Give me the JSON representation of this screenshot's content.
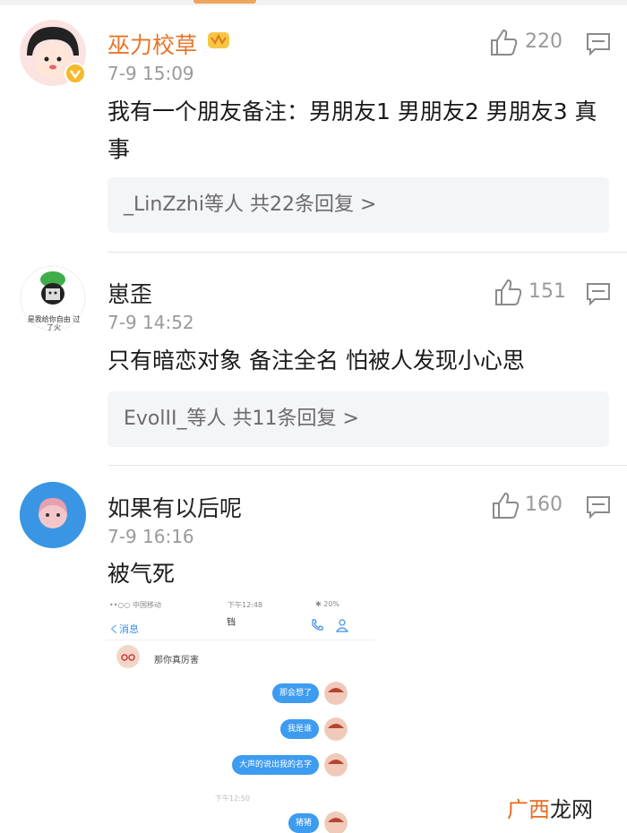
{
  "comments": [
    {
      "username": "巫力校草",
      "time": "7-9 15:09",
      "content": "我有一个朋友备注：男朋友1 男朋友2 男朋友3 真事",
      "reply_summary": "_LinZzhi等人  共22条回复 >",
      "likes": "220"
    },
    {
      "username": "崽歪",
      "avatar_caption": "是我给你自由 过了火",
      "time": "7-9 14:52",
      "content": "只有暗恋对象 备注全名 怕被人发现小心思",
      "reply_summary": "EvolII_等人  共11条回复 >",
      "likes": "151"
    },
    {
      "username": "如果有以后呢",
      "time": "7-9 16:16",
      "content": "被气死",
      "likes": "160"
    }
  ],
  "chat_image": {
    "carrier": "••○○ 中国移动",
    "clock": "下午12:48",
    "battery": "✱ 20%",
    "back": "く消息",
    "title": "铛",
    "incoming": "那你真厉害",
    "outgoing": [
      "那会想了",
      "我是谁",
      "大声的说出我的名字",
      "猪猪"
    ],
    "timestamp": "下午12:50"
  },
  "watermark": {
    "part1": "广西",
    "part2": "龙网"
  },
  "colors": {
    "username_accent": "#e8742a",
    "bubble": "#3d9bf0",
    "meta": "#9a9a9a"
  }
}
